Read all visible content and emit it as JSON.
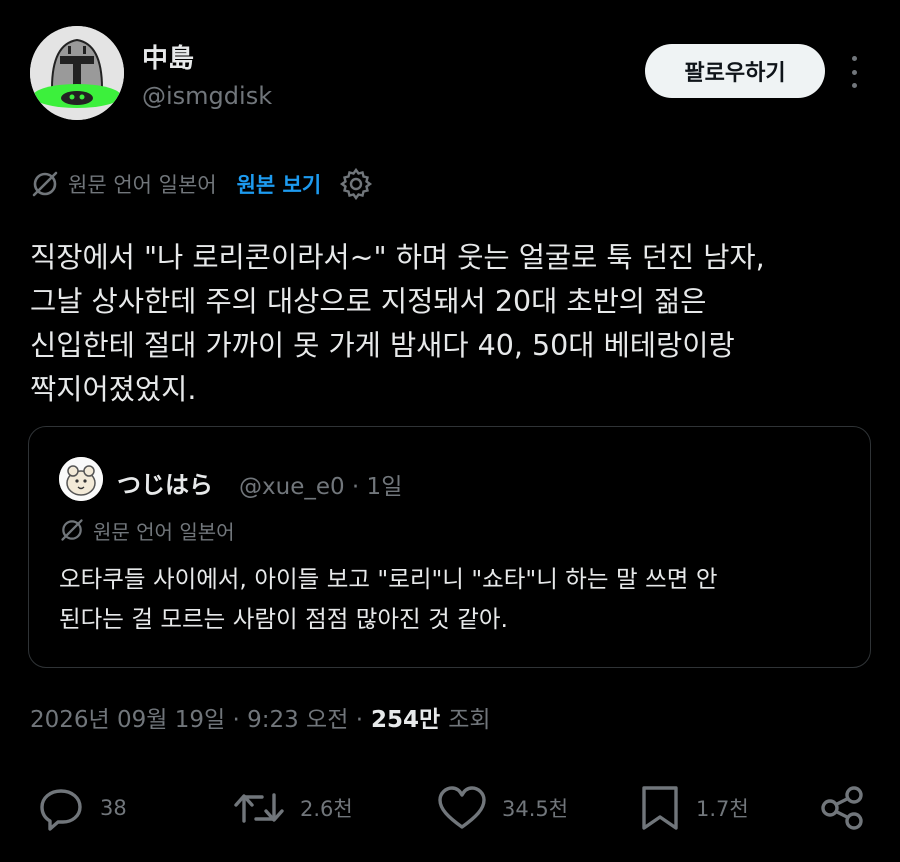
{
  "author": {
    "name": "中島",
    "handle": "@ismgdisk"
  },
  "follow_label": "팔로우하기",
  "translation": {
    "text": "원문 언어 일본어",
    "show_original": "원본 보기"
  },
  "tweet_text": "직장에서 \"나 로리콘이라서~\" 하며 웃는 얼굴로 툭 던진 남자,\n그날 상사한테 주의 대상으로 지정돼서 20대 초반의 젊은\n신입한테 절대 가까이 못 가게 밤새다 40, 50대 베테랑이랑\n짝지어졌었지.",
  "quoted": {
    "name": "つじはら",
    "meta": "@xue_e0 · 1일",
    "translation": "원문 언어 일본어",
    "text": "오타쿠들 사이에서, 아이들 보고 \"로리\"니 \"쇼타\"니 하는 말 쓰면 안\n된다는 걸 모르는 사람이 점점 많아진 것 같아."
  },
  "timestamp": "2026년 09월 19일 · 9:23 오전 ·",
  "views": "254만",
  "views_label": "조회",
  "actions": {
    "reply_count": "38",
    "retweet_count": "2.6천",
    "like_count": "34.5천",
    "bookmark_count": "1.7천"
  },
  "colors": {
    "background": "#000000",
    "text": "#e7e9ea",
    "muted": "#71767b",
    "link": "#1d9bf0",
    "border": "#2f3336"
  }
}
